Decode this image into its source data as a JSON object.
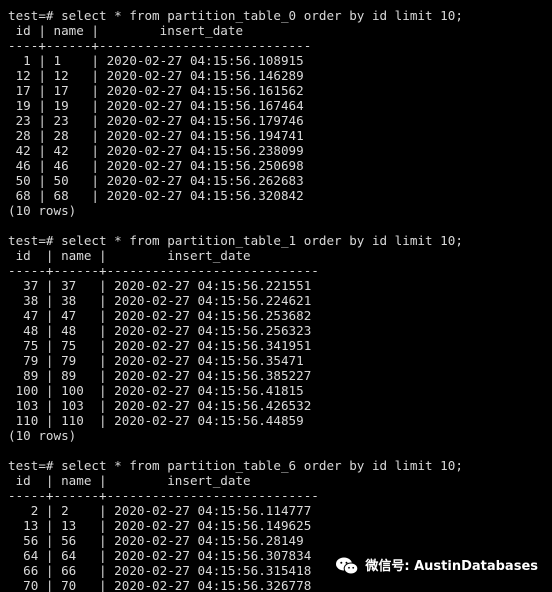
{
  "terminal": {
    "lines": [
      "test=# select * from partition_table_0 order by id limit 10;",
      " id | name |        insert_date",
      "----+------+----------------------------",
      "  1 | 1    | 2020-02-27 04:15:56.108915",
      " 12 | 12   | 2020-02-27 04:15:56.146289",
      " 17 | 17   | 2020-02-27 04:15:56.161562",
      " 19 | 19   | 2020-02-27 04:15:56.167464",
      " 23 | 23   | 2020-02-27 04:15:56.179746",
      " 28 | 28   | 2020-02-27 04:15:56.194741",
      " 42 | 42   | 2020-02-27 04:15:56.238099",
      " 46 | 46   | 2020-02-27 04:15:56.250698",
      " 50 | 50   | 2020-02-27 04:15:56.262683",
      " 68 | 68   | 2020-02-27 04:15:56.320842",
      "(10 rows)",
      "",
      "test=# select * from partition_table_1 order by id limit 10;",
      " id  | name |        insert_date",
      "-----+------+----------------------------",
      "  37 | 37   | 2020-02-27 04:15:56.221551",
      "  38 | 38   | 2020-02-27 04:15:56.224621",
      "  47 | 47   | 2020-02-27 04:15:56.253682",
      "  48 | 48   | 2020-02-27 04:15:56.256323",
      "  75 | 75   | 2020-02-27 04:15:56.341951",
      "  79 | 79   | 2020-02-27 04:15:56.35471",
      "  89 | 89   | 2020-02-27 04:15:56.385227",
      " 100 | 100  | 2020-02-27 04:15:56.41815",
      " 103 | 103  | 2020-02-27 04:15:56.426532",
      " 110 | 110  | 2020-02-27 04:15:56.44859",
      "(10 rows)",
      "",
      "test=# select * from partition_table_6 order by id limit 10;",
      " id  | name |        insert_date",
      "-----+------+----------------------------",
      "   2 | 2    | 2020-02-27 04:15:56.114777",
      "  13 | 13   | 2020-02-27 04:15:56.149625",
      "  56 | 56   | 2020-02-27 04:15:56.28149",
      "  64 | 64   | 2020-02-27 04:15:56.307834",
      "  66 | 66   | 2020-02-27 04:15:56.315418",
      "  70 | 70   | 2020-02-27 04:15:56.326778"
    ]
  },
  "watermark": {
    "text": "微信号: AustinDatabases",
    "icon": "wechat-icon"
  },
  "colors": {
    "background": "#000000",
    "foreground": "#d9d9d9",
    "watermark": "#ffffff"
  }
}
